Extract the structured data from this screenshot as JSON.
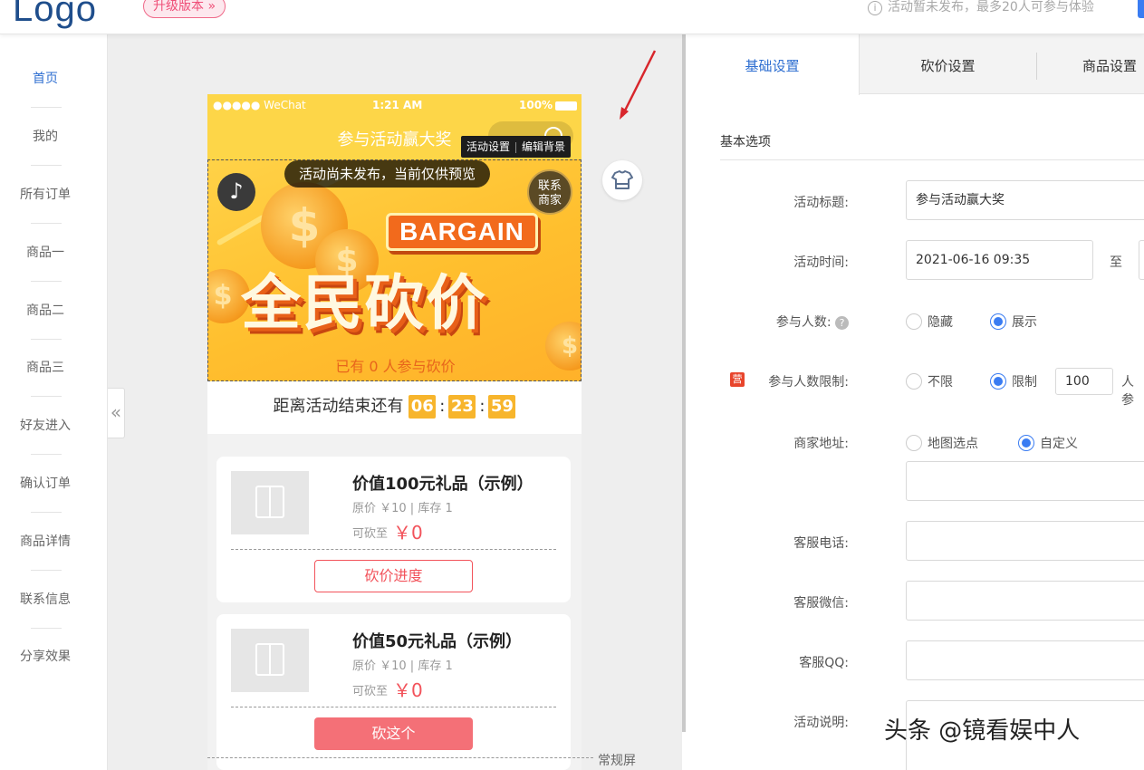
{
  "header": {
    "logo": "Logo",
    "upgrade_label": "升级版本 »",
    "notice": "活动暂未发布，最多20人可参与体验"
  },
  "sidebar": {
    "items": [
      "首页",
      "我的",
      "所有订单",
      "商品一",
      "商品二",
      "商品三",
      "好友进入",
      "确认订单",
      "商品详情",
      "联系信息",
      "分享效果"
    ],
    "active": "首页"
  },
  "collapse_icon": "«",
  "phone": {
    "status": {
      "carrier": "●●●●● WeChat",
      "time": "1:21 AM",
      "battery": "100%"
    },
    "nav_title": "参与活动赢大奖",
    "tooltip": {
      "activity_settings": "活动设置",
      "edit_background": "编辑背景"
    },
    "banner": {
      "preview_notice": "活动尚未发布，当前仅供预览",
      "music_icon": "♪",
      "contact_label": "联系\n商家",
      "bargain_tag": "BARGAIN",
      "big_title": "全民砍价",
      "joined_text": "已有 0 人参与砍价"
    },
    "countdown": {
      "label": "距离活动结束还有",
      "hours": "06",
      "minutes": "23",
      "seconds": "59"
    },
    "products": [
      {
        "title": "价值100元礼品（示例）",
        "meta": "原价 ￥10 | 库存 1",
        "price_label": "可砍至",
        "price": "￥0",
        "button": "砍价进度"
      },
      {
        "title": "价值50元礼品（示例）",
        "meta": "原价 ￥10 | 库存 1",
        "price_label": "可砍至",
        "price": "￥0",
        "button": "砍这个"
      }
    ]
  },
  "screen_label": "常规屏",
  "panel": {
    "tabs": [
      "基础设置",
      "砍价设置",
      "商品设置"
    ],
    "active_tab": "基础设置",
    "section_title": "基本选项",
    "fields": {
      "title_label": "活动标题:",
      "title_value": "参与活动赢大奖",
      "time_label": "活动时间:",
      "time_start": "2021-06-16 09:35",
      "time_to": "至",
      "participants_label": "参与人数:",
      "participants_options": [
        "隐藏",
        "展示"
      ],
      "limit_label": "参与人数限制:",
      "limit_options": [
        "不限",
        "限制"
      ],
      "limit_value": "100",
      "limit_unit": "人参",
      "ying_badge": "营",
      "address_label": "商家地址:",
      "address_options": [
        "地图选点",
        "自定义"
      ],
      "phone_label": "客服电话:",
      "wechat_label": "客服微信:",
      "qq_label": "客服QQ:",
      "desc_label": "活动说明:"
    }
  },
  "watermark": "头条 @镜看娱中人",
  "colors": {
    "accent_blue": "#2f6fd1",
    "brand_yellow": "#fdd648",
    "price_red": "#f2535b",
    "countdown_orange": "#f7b52c"
  }
}
